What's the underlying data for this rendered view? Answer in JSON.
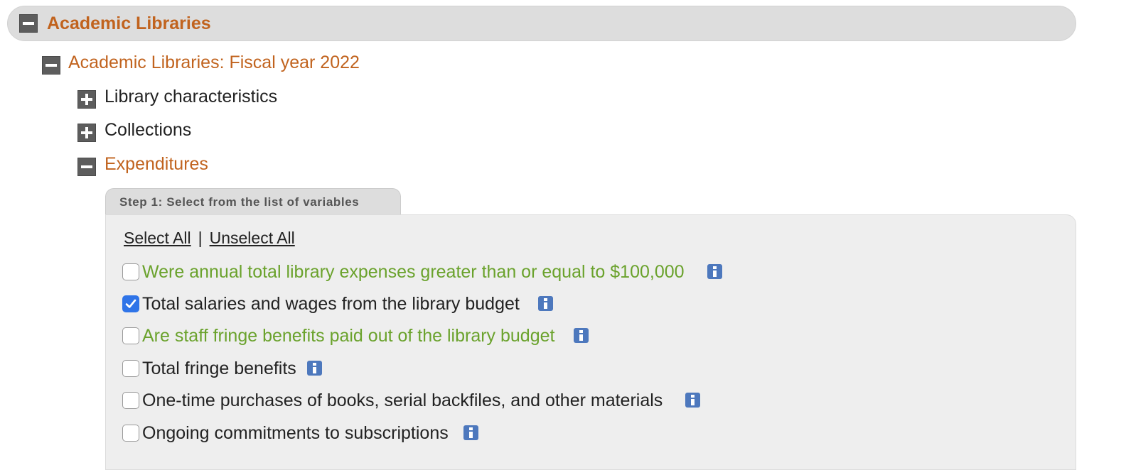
{
  "tree": {
    "root": {
      "label": "Academic Libraries",
      "state": "expanded"
    },
    "year": {
      "label": "Academic Libraries: Fiscal year 2022",
      "state": "expanded"
    },
    "categories": [
      {
        "label": "Library characteristics",
        "state": "collapsed"
      },
      {
        "label": "Collections",
        "state": "collapsed"
      },
      {
        "label": "Expenditures",
        "state": "expanded"
      }
    ]
  },
  "step": {
    "title": "Step 1: Select from the list of variables"
  },
  "selection": {
    "select_all": "Select All",
    "separator": "|",
    "unselect_all": "Unselect All"
  },
  "variables": [
    {
      "label": "Were annual total library expenses greater than or equal to $100,000",
      "checked": false,
      "color": "#6aa22c"
    },
    {
      "label": "Total salaries and wages from the library budget",
      "checked": true,
      "color": "#222222"
    },
    {
      "label": "Are staff fringe benefits paid out of the library budget",
      "checked": false,
      "color": "#6aa22c"
    },
    {
      "label": "Total fringe benefits",
      "checked": false,
      "color": "#222222"
    },
    {
      "label": "One-time purchases of books, serial backfiles, and other materials",
      "checked": false,
      "color": "#222222"
    },
    {
      "label": "Ongoing commitments to subscriptions",
      "checked": false,
      "color": "#222222"
    }
  ],
  "colors": {
    "accent_orange": "#c1631e",
    "variable_green": "#6aa22c",
    "checkbox_blue": "#2f74e8",
    "info_blue": "#4d78bd"
  },
  "icons": {
    "expanded": "minus-square-icon",
    "collapsed": "plus-square-icon",
    "info": "info-icon",
    "check": "checkmark-icon"
  }
}
